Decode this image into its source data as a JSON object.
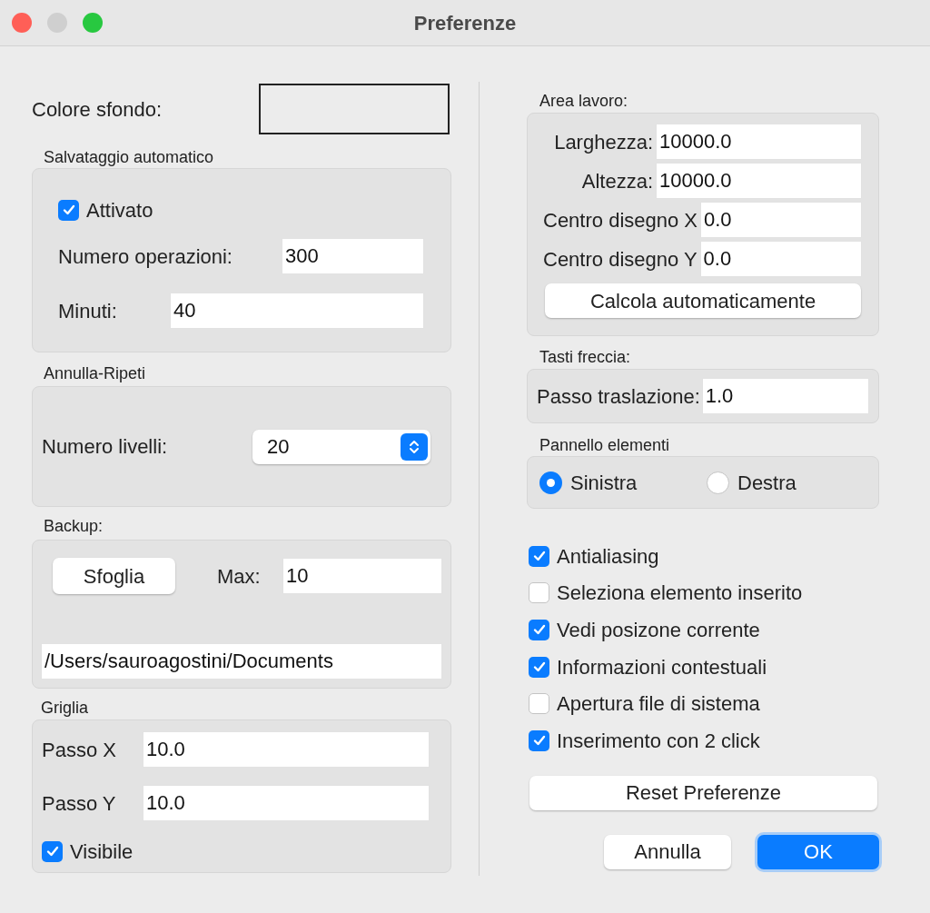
{
  "window": {
    "title": "Preferenze"
  },
  "background_color": {
    "label": "Colore sfondo:"
  },
  "autosave": {
    "title": "Salvataggio automatico",
    "enabled": {
      "label": "Attivato",
      "checked": true
    },
    "operations": {
      "label": "Numero operazioni:",
      "value": "300"
    },
    "minutes": {
      "label": "Minuti:",
      "value": "40"
    }
  },
  "undo": {
    "title": "Annulla-Ripeti",
    "levels": {
      "label": "Numero livelli:",
      "value": "20"
    }
  },
  "backup": {
    "title": "Backup:",
    "browse_button": "Sfoglia",
    "max": {
      "label": "Max:",
      "value": "10"
    },
    "path": "/Users/sauroagostini/Documents"
  },
  "grid": {
    "title": "Griglia",
    "step_x": {
      "label": "Passo X",
      "value": "10.0"
    },
    "step_y": {
      "label": "Passo Y",
      "value": "10.0"
    },
    "visible": {
      "label": "Visibile",
      "checked": true
    }
  },
  "work_area": {
    "title": "Area lavoro:",
    "fields": [
      {
        "label": "Larghezza:",
        "value": "10000.0"
      },
      {
        "label": "Altezza:",
        "value": "10000.0"
      },
      {
        "label": "Centro disegno X",
        "value": "0.0"
      },
      {
        "label": "Centro disegno Y",
        "value": "0.0"
      }
    ],
    "auto_button": "Calcola automaticamente"
  },
  "arrow_keys": {
    "title": "Tasti freccia:",
    "step": {
      "label": "Passo traslazione:",
      "value": "1.0"
    }
  },
  "elements_panel": {
    "title": "Pannello elementi",
    "options": [
      {
        "label": "Sinistra",
        "selected": true
      },
      {
        "label": "Destra",
        "selected": false
      }
    ]
  },
  "options": [
    {
      "label": "Antialiasing",
      "checked": true
    },
    {
      "label": "Seleziona elemento inserito",
      "checked": false
    },
    {
      "label": "Vedi posizone corrente",
      "checked": true
    },
    {
      "label": "Informazioni contestuali",
      "checked": true
    },
    {
      "label": "Apertura file di sistema",
      "checked": false
    },
    {
      "label": "Inserimento con 2 click",
      "checked": true
    }
  ],
  "reset_button": "Reset Preferenze",
  "buttons": [
    {
      "label": "Annulla",
      "kind": "secondary"
    },
    {
      "label": "OK",
      "kind": "primary"
    }
  ]
}
